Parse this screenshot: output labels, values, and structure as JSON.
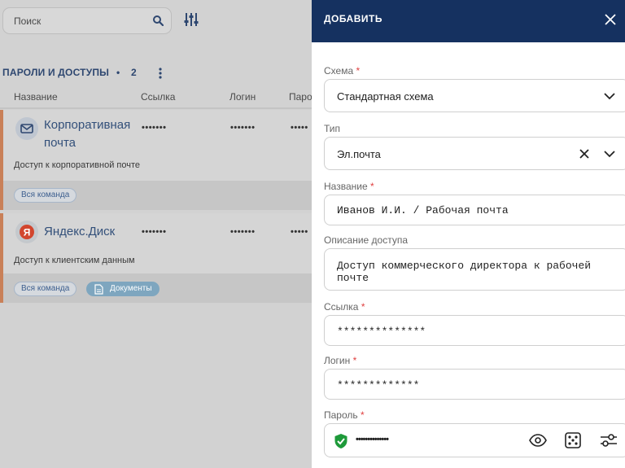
{
  "search": {
    "placeholder": "Поиск"
  },
  "section": {
    "title": "ПАРОЛИ И ДОСТУПЫ",
    "separator": "•",
    "count": "2"
  },
  "columns": [
    "Название",
    "Ссылка",
    "Логин",
    "Паро"
  ],
  "entries": [
    {
      "icon": "mail-icon",
      "name_line1": "Корпоративная",
      "name_line2": "почта",
      "link": "•••••••",
      "login": "•••••••",
      "password": "•••••",
      "description": "Доступ к корпоративной почте",
      "tags": [
        "Вся команда"
      ]
    },
    {
      "icon": "yandex-icon",
      "name_line1": "Яндекс.Диск",
      "link": "•••••••",
      "login": "•••••••",
      "password": "•••••",
      "description": "Доступ к клиентским данным",
      "tags": [
        "Вся команда",
        "Документы"
      ]
    }
  ],
  "drawer": {
    "title": "ДОБАВИТЬ",
    "fields": {
      "scheme": {
        "label": "Схема",
        "required": "*",
        "value": "Стандартная схема"
      },
      "type": {
        "label": "Тип",
        "value": "Эл.почта"
      },
      "name": {
        "label": "Название",
        "required": "*",
        "value": "Иванов И.И. / Рабочая почта"
      },
      "description": {
        "label": "Описание доступа",
        "value_line1": "Доступ коммерческого директора к рабочей",
        "value_line2": "почте"
      },
      "link": {
        "label": "Ссылка",
        "required": "*",
        "value": "**************"
      },
      "login": {
        "label": "Логин",
        "required": "*",
        "value": "*************"
      },
      "password": {
        "label": "Пароль",
        "required": "*",
        "value": "••••••••••••••"
      }
    }
  },
  "colors": {
    "drawer_header": "#153160",
    "accent_stripe": "#c98058",
    "shield_green": "#1e9a3a",
    "required": "#e04040"
  }
}
